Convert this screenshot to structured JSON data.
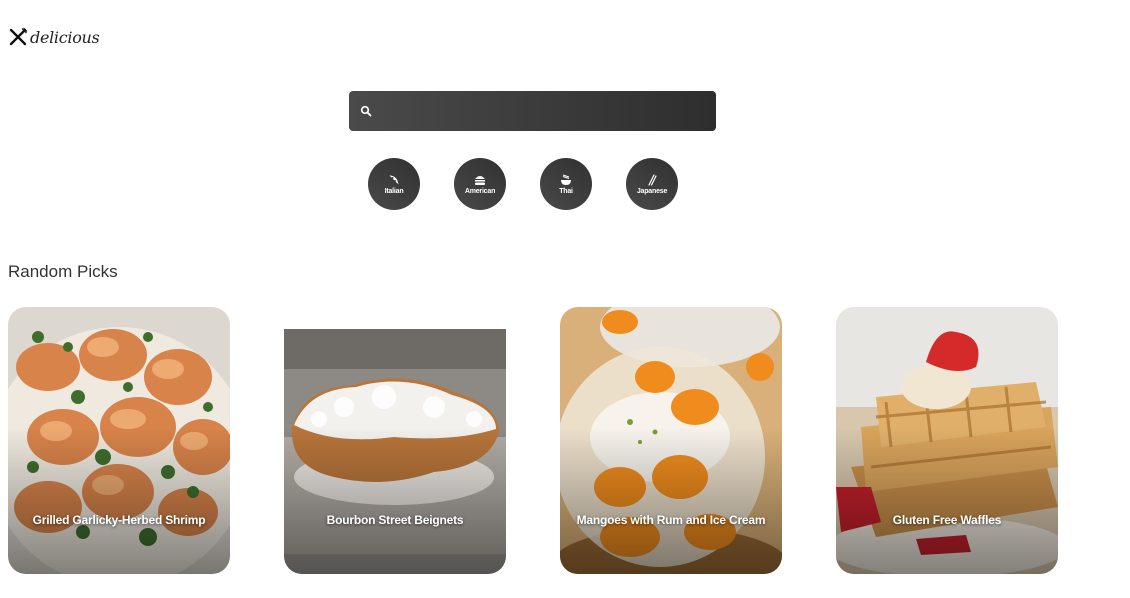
{
  "brand": {
    "name": "delicious"
  },
  "search": {
    "value": "",
    "placeholder": ""
  },
  "cuisines": [
    {
      "label": "Italian",
      "icon": "pizza-icon"
    },
    {
      "label": "American",
      "icon": "burger-icon"
    },
    {
      "label": "Thai",
      "icon": "noodle-bowl-icon"
    },
    {
      "label": "Japanese",
      "icon": "chopsticks-icon"
    }
  ],
  "section": {
    "title": "Random Picks"
  },
  "recipes": [
    {
      "title": "Grilled Garlicky-Herbed Shrimp"
    },
    {
      "title": "Bourbon Street Beignets"
    },
    {
      "title": "Mangoes with Rum and Ice Cream"
    },
    {
      "title": "Gluten Free Waffles"
    }
  ],
  "colors": {
    "button_bg": "#3a3a3a",
    "search_bg": "#3d3d3d",
    "text": "#333333"
  }
}
